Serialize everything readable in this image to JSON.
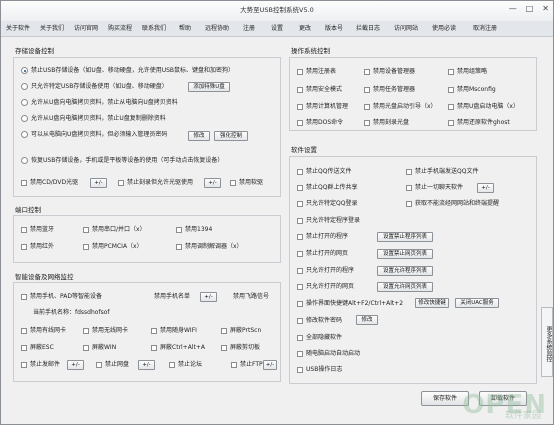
{
  "title": "大势至USB控制系统V5.0",
  "menu": [
    "关于软件",
    "关于我们",
    "访问官网",
    "购买流程",
    "联系我们",
    "帮助",
    "远程协助",
    "注册",
    "设置",
    "更改",
    "版本号",
    "拦截日志",
    "访问网站",
    "使用必读",
    "取消注册"
  ],
  "storage": {
    "header": "存储设备控制",
    "opt1": "禁止USB存储设备（如U盘、移动硬盘，允许使用USB鼠标、键盘和加密狗）",
    "opt2": "只允许特定USB存储设备使用（如U盘、移动硬盘）",
    "opt2_btn": "添加特殊U盘",
    "opt3": "允许从U盘向电脑拷贝资料，禁止从电脑向U盘拷贝资料",
    "opt4": "允许从U盘向电脑拷贝资料，禁止U盘复制删除资料",
    "opt5": "可以从电脑向U盘拷贝资料，但必须输入管理员密码",
    "opt5_btn1": "修改",
    "opt5_btn2": "强化控制",
    "opt6": "恢复USB存储设备，手机或是平板等设备的使用（可手动点击恢复设备）",
    "cd": "禁用CD/DVD光驱",
    "plus1": "+/-",
    "cd2": "禁止刻录但允许光驱使用",
    "plus2": "+/-",
    "floppy": "禁用软驱"
  },
  "ports": {
    "header": "端口控制",
    "items": [
      "禁用蓝牙",
      "禁用串口/并口（x）",
      "禁用1394",
      "禁用红外",
      "禁用PCMCIA（x）",
      "禁用调制解调器（x）"
    ]
  },
  "network": {
    "header": "智能设备及网络监控",
    "phone": "禁用手机、PAD等智能设备",
    "phone_list": "禁用手机名单",
    "phone_plus": "+/-",
    "flight": "禁用飞路信号",
    "current_phone": "当前手机名称：fdssdhofsof",
    "r1": [
      "禁用有线网卡",
      "禁用无线网卡",
      "禁用随身WIFI",
      "屏蔽PrtScn"
    ],
    "r2": [
      "屏蔽ESC",
      "屏蔽WIN",
      "屏蔽Ctrl+Alt+A",
      "屏蔽剪切板"
    ],
    "r3": [
      "禁止发邮件",
      "禁止网盘",
      "禁止论坛",
      "禁止FTP"
    ],
    "plus": "+/-"
  },
  "os": {
    "header": "操作系统控制",
    "items": [
      "禁用注册表",
      "禁用设备管理器",
      "禁用组策略",
      "禁用安全模式",
      "禁用任务管理器",
      "禁用Msconfig",
      "禁用计算机管理",
      "禁用光盘启动引导（x）",
      "禁用U盘启动电脑（x）",
      "禁用DOS命令",
      "禁用刻录光盘",
      "禁用还原软件ghost"
    ]
  },
  "software": {
    "header": "软件设置",
    "qq_file": "禁止QQ传送文件",
    "qq_file_r": "禁止手机端发送QQ文件",
    "qq_cloud": "禁止QQ群上传共享",
    "all_files": "禁止一切聊天软件",
    "all_plus": "+/-",
    "qq_login": "只允许特定QQ登录",
    "net_sw": "获取不能流经网网站和终端提醒",
    "run_sw": "只允许特定程序登录",
    "b1": "禁止打开的程序",
    "b1_btn": "设置禁止程序列表",
    "b2": "禁止打开的网页",
    "b2_btn": "设置禁止网页列表",
    "b3": "只允许打开的程序",
    "b3_btn": "设置允许程序列表",
    "b4": "只允许打开的网页",
    "b4_btn": "设置允许网页列表",
    "hotkey": "操作界面快捷键Alt+F2/Ctrl+Alt+2",
    "hotkey_btn1": "修改快捷键",
    "hotkey_btn2": "关闭UAC服务",
    "pwd": "修改软件密码",
    "pwd_btn": "修改",
    "hide": "全部隐藏软件",
    "auto": "随电脑启动自动启动",
    "log": "USB操作日志"
  },
  "footer": {
    "apply": "保存软件",
    "cancel": "卸载软件"
  },
  "sidetab": "更多系统监控",
  "watermark": "OPEN",
  "watermark_sub": "软件家园"
}
